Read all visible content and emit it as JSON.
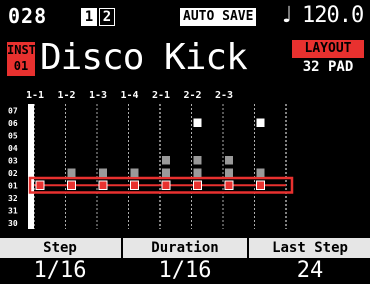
{
  "status": {
    "pattern_number": "028",
    "banks": [
      "1",
      "2"
    ],
    "autosave_label": "AUTO SAVE",
    "tempo_icon": "quarter-note-icon",
    "tempo": "120.0"
  },
  "instrument": {
    "badge_line1": "INST",
    "badge_line2": "01",
    "name": "Disco Kick",
    "layout_label": "LAYOUT",
    "layout_value": "32 PAD"
  },
  "grid": {
    "column_headers": [
      "1-1",
      "1-2",
      "1-3",
      "1-4",
      "2-1",
      "2-2",
      "2-3"
    ],
    "row_labels": [
      "07",
      "06",
      "05",
      "04",
      "03",
      "02",
      "01",
      "32",
      "31",
      "30"
    ],
    "selected_row": "01",
    "num_steps": 8,
    "active_notes": [
      {
        "row": "06",
        "step": 5
      },
      {
        "row": "06",
        "step": 7
      },
      {
        "row": "03",
        "step": 4
      },
      {
        "row": "03",
        "step": 5
      },
      {
        "row": "03",
        "step": 6
      },
      {
        "row": "02",
        "step": 1
      },
      {
        "row": "02",
        "step": 2
      },
      {
        "row": "02",
        "step": 3
      },
      {
        "row": "02",
        "step": 4
      },
      {
        "row": "02",
        "step": 5
      },
      {
        "row": "02",
        "step": 6
      },
      {
        "row": "02",
        "step": 7
      },
      {
        "row": "01",
        "step": 0
      },
      {
        "row": "01",
        "step": 1
      },
      {
        "row": "01",
        "step": 2
      },
      {
        "row": "01",
        "step": 3
      },
      {
        "row": "01",
        "step": 4
      },
      {
        "row": "01",
        "step": 5
      },
      {
        "row": "01",
        "step": 6
      },
      {
        "row": "01",
        "step": 7
      }
    ],
    "colors": {
      "accent_red": "#e8312f",
      "note_white": "#ffffff",
      "note_gray": "#9a9a9a",
      "grid_line": "#ffffff"
    }
  },
  "params": {
    "step_label": "Step",
    "step_value": "1/16",
    "duration_label": "Duration",
    "duration_value": "1/16",
    "last_step_label": "Last Step",
    "last_step_value": "24"
  }
}
